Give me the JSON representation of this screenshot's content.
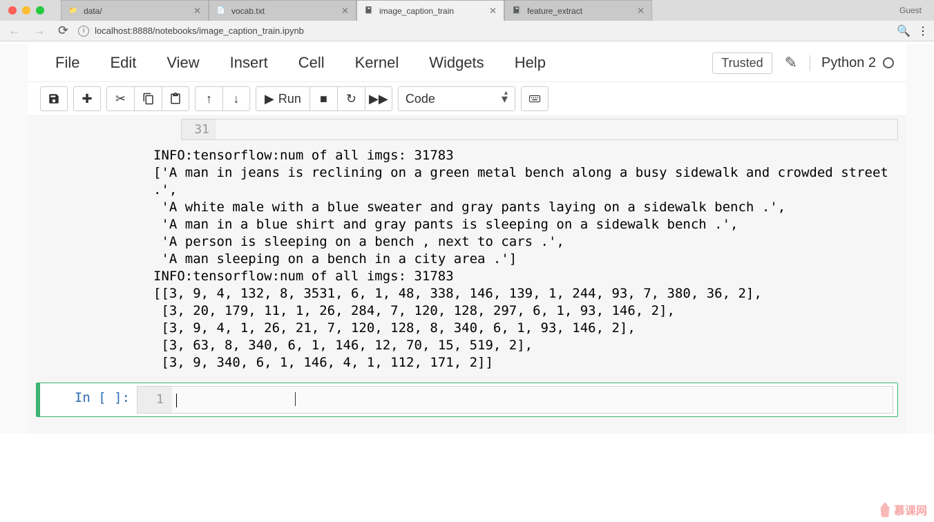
{
  "browser": {
    "tabs": [
      {
        "title": "data/",
        "active": false
      },
      {
        "title": "vocab.txt",
        "active": false
      },
      {
        "title": "image_caption_train",
        "active": true
      },
      {
        "title": "feature_extract",
        "active": false
      }
    ],
    "guest_label": "Guest",
    "url": "localhost:8888/notebooks/image_caption_train.ipynb"
  },
  "menu": {
    "items": [
      "File",
      "Edit",
      "View",
      "Insert",
      "Cell",
      "Kernel",
      "Widgets",
      "Help"
    ],
    "trusted": "Trusted",
    "kernel": "Python 2"
  },
  "toolbar": {
    "run_label": "Run",
    "cell_type": "Code"
  },
  "cells": {
    "code_gutter": "31",
    "output": "INFO:tensorflow:num of all imgs: 31783\n['A man in jeans is reclining on a green metal bench along a busy sidewalk and crowded street .',\n 'A white male with a blue sweater and gray pants laying on a sidewalk bench .',\n 'A man in a blue shirt and gray pants is sleeping on a sidewalk bench .',\n 'A person is sleeping on a bench , next to cars .',\n 'A man sleeping on a bench in a city area .']\nINFO:tensorflow:num of all imgs: 31783\n[[3, 9, 4, 132, 8, 3531, 6, 1, 48, 338, 146, 139, 1, 244, 93, 7, 380, 36, 2],\n [3, 20, 179, 11, 1, 26, 284, 7, 120, 128, 297, 6, 1, 93, 146, 2],\n [3, 9, 4, 1, 26, 21, 7, 120, 128, 8, 340, 6, 1, 93, 146, 2],\n [3, 63, 8, 340, 6, 1, 146, 12, 70, 15, 519, 2],\n [3, 9, 340, 6, 1, 146, 4, 1, 112, 171, 2]]",
    "input_prompt": "In [ ]:",
    "input_gutter": "1"
  },
  "watermark": "慕课网"
}
